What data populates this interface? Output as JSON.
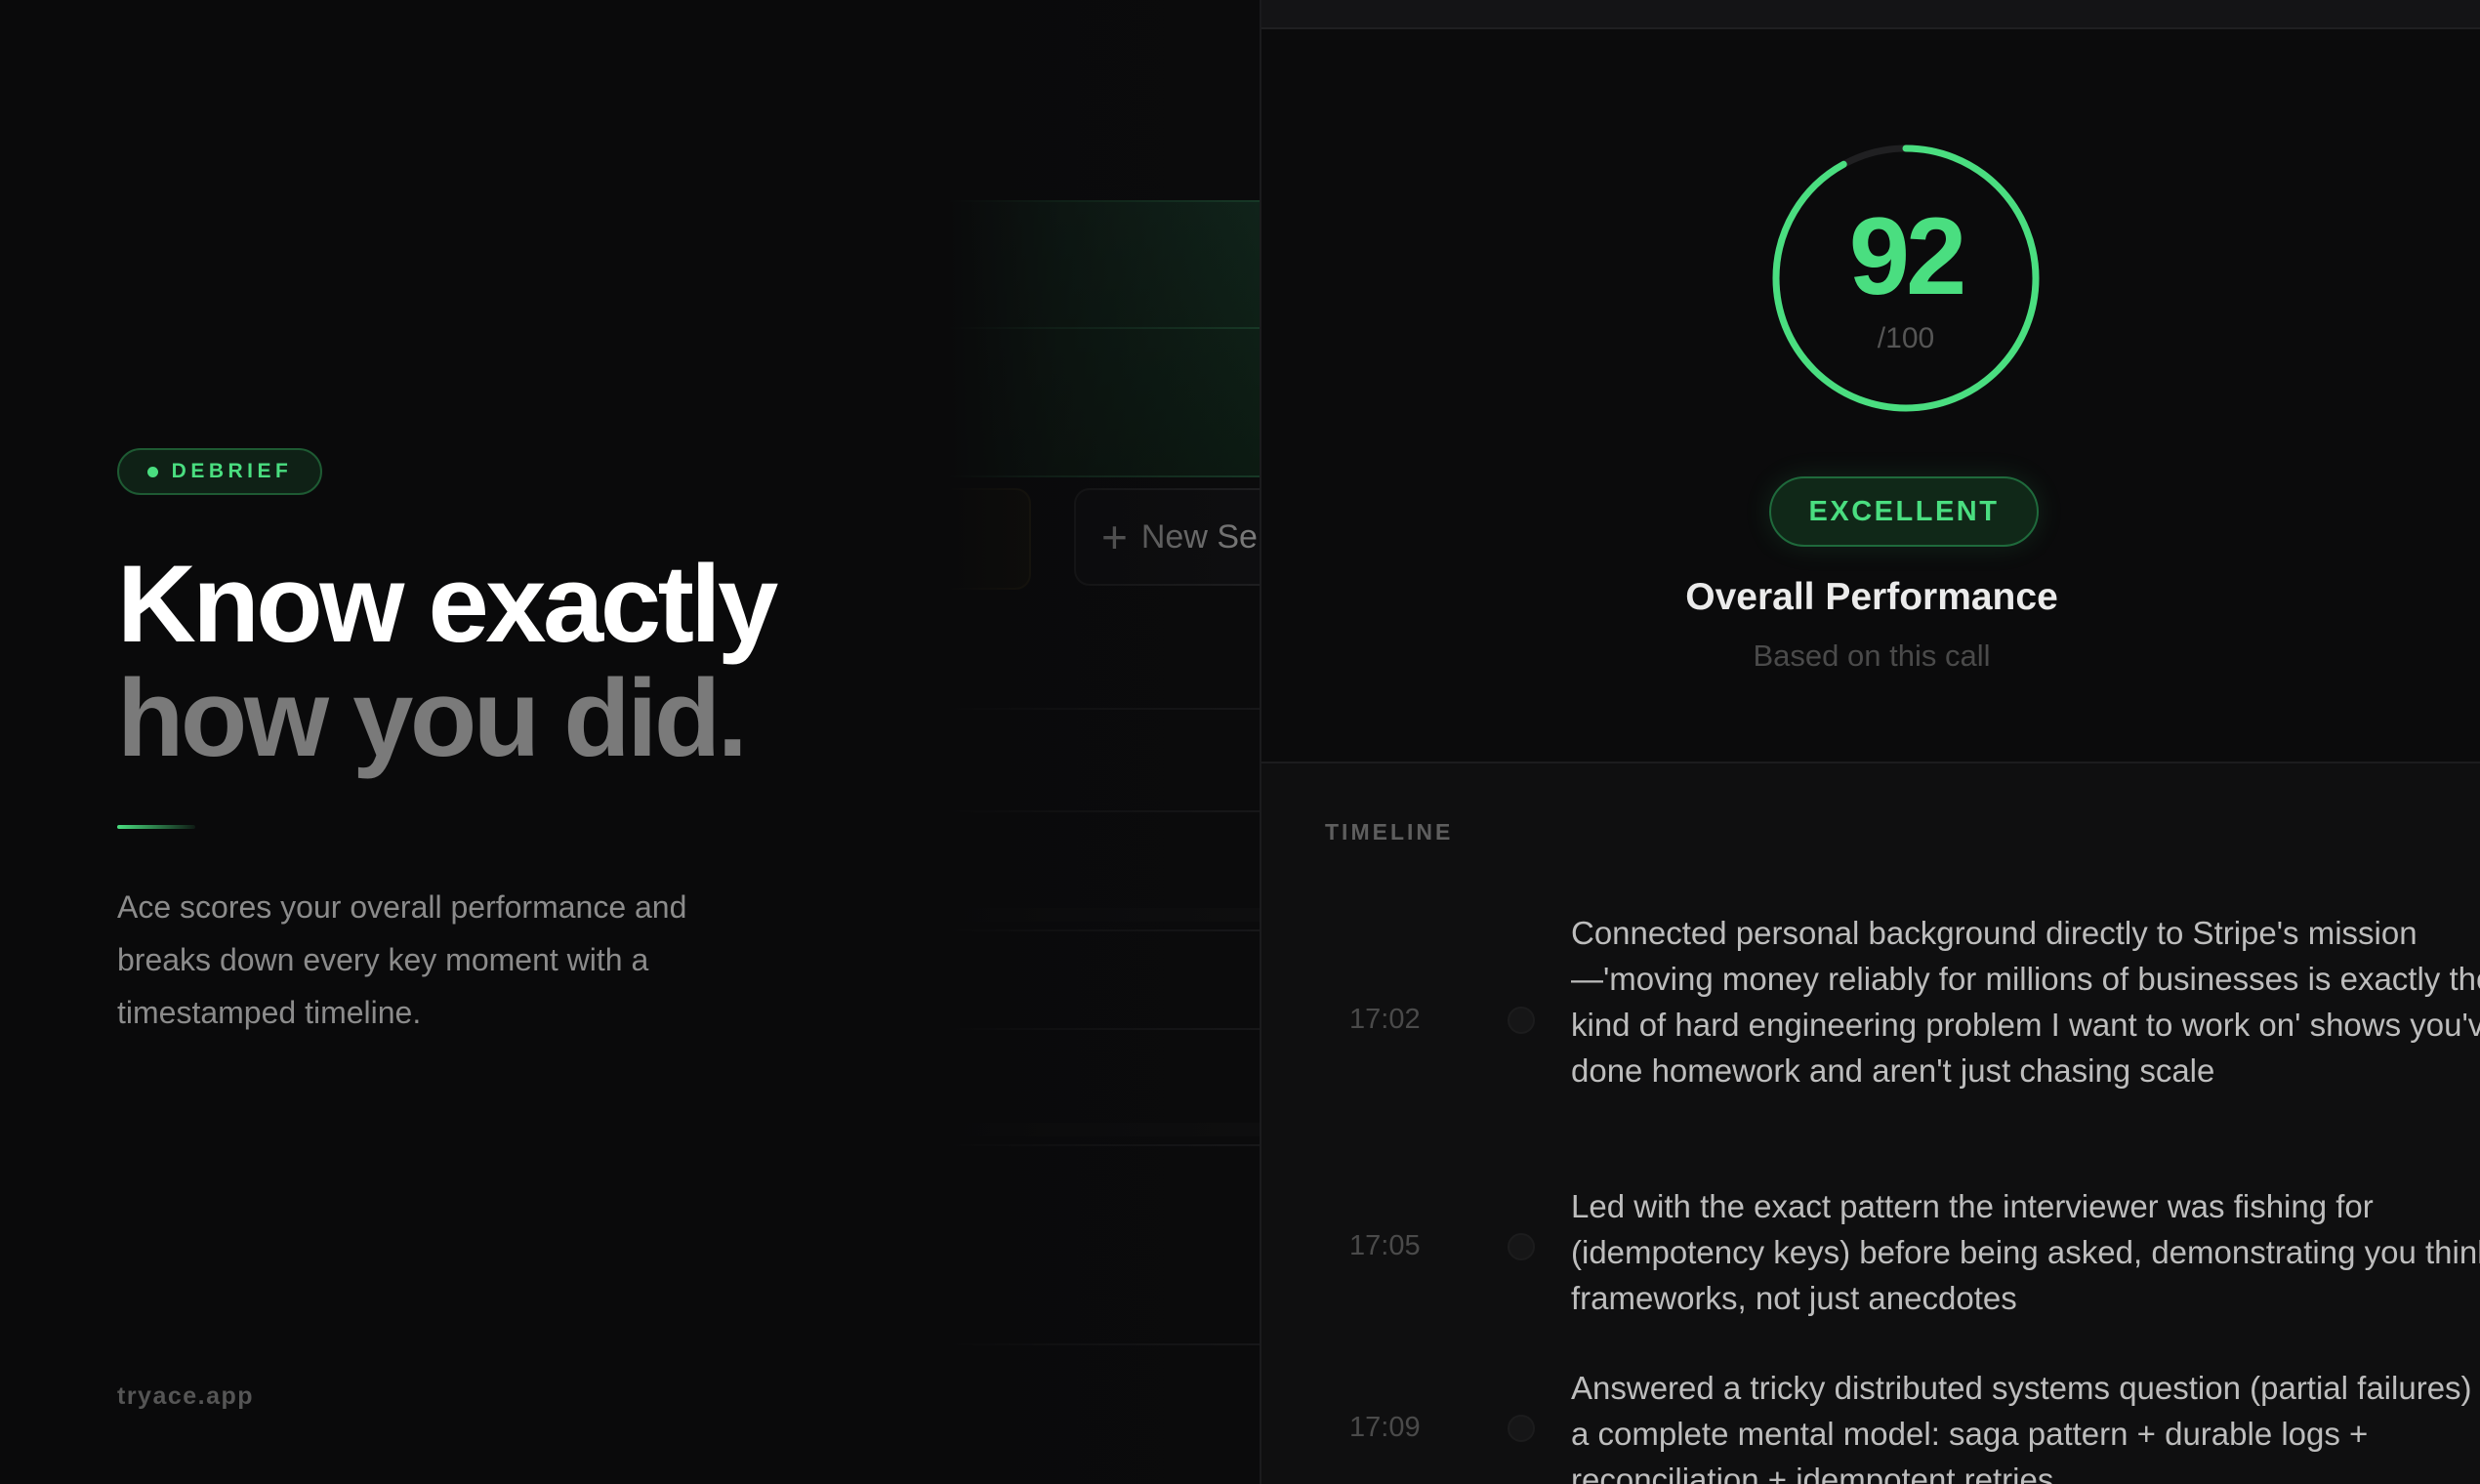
{
  "badge": {
    "label": "DEBRIEF"
  },
  "headline": {
    "line1": "Know exactly",
    "line2": "how you did."
  },
  "description": "Ace scores your overall performance and breaks down every key moment with a timestamped timeline.",
  "footer": {
    "site": "tryace.app"
  },
  "background_app": {
    "new_button_label": "New Se"
  },
  "score": {
    "value": "92",
    "denominator": "/100",
    "fraction": 0.92,
    "rating": "EXCELLENT",
    "title": "Overall Performance",
    "subtitle": "Based on this call"
  },
  "timeline": {
    "label": "TIMELINE",
    "items": [
      {
        "time": "17:02",
        "text": "Connected personal background directly to Stripe's mission —'moving money reliably for millions of businesses is exactly the kind of hard engineering problem I want to work on' shows you've done homework and aren't just chasing scale"
      },
      {
        "time": "17:05",
        "text": "Led with the exact pattern the interviewer was fishing for (idempotency keys) before being asked, demonstrating you think in frameworks, not just anecdotes"
      },
      {
        "time": "17:09",
        "text": "Answered a tricky distributed systems question (partial failures) with a complete mental model: saga pattern + durable logs + reconciliation + idempotent retries"
      }
    ]
  },
  "colors": {
    "accent": "#4ade80",
    "background": "#0a0a0b",
    "muted_text": "#8b8b8b"
  }
}
